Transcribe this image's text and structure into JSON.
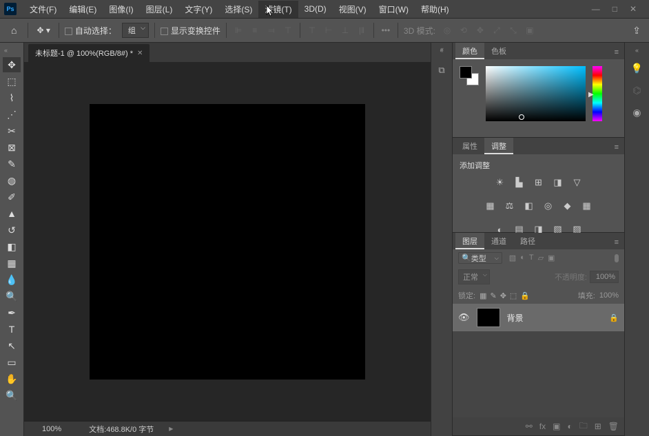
{
  "app": {
    "logo": "Ps"
  },
  "menu": {
    "file": "文件(F)",
    "edit": "编辑(E)",
    "image": "图像(I)",
    "layer": "图层(L)",
    "type": "文字(Y)",
    "select": "选择(S)",
    "filter": "滤镜(T)",
    "threeD": "3D(D)",
    "view": "视图(V)",
    "window": "窗口(W)",
    "help": "帮助(H)"
  },
  "win": {
    "min": "—",
    "max": "□",
    "close": "✕"
  },
  "options": {
    "auto_select": "自动选择：",
    "group": "组",
    "show_transform": "显示变换控件",
    "threeD_mode": "3D 模式:"
  },
  "doc": {
    "tab_title": "未标题-1 @ 100%(RGB/8#) *",
    "zoom": "100%",
    "info": "文档:468.8K/0 字节"
  },
  "panels": {
    "color": {
      "tab1": "颜色",
      "tab2": "色板"
    },
    "props": {
      "tab1": "属性",
      "tab2": "调整",
      "label": "添加调整"
    },
    "layers": {
      "tab1": "图层",
      "tab2": "通道",
      "tab3": "路径",
      "search": "类型",
      "blend": "正常",
      "opacity_label": "不透明度:",
      "opacity": "100%",
      "lock_label": "锁定:",
      "fill_label": "填充:",
      "fill": "100%",
      "item_name": "背景"
    }
  }
}
